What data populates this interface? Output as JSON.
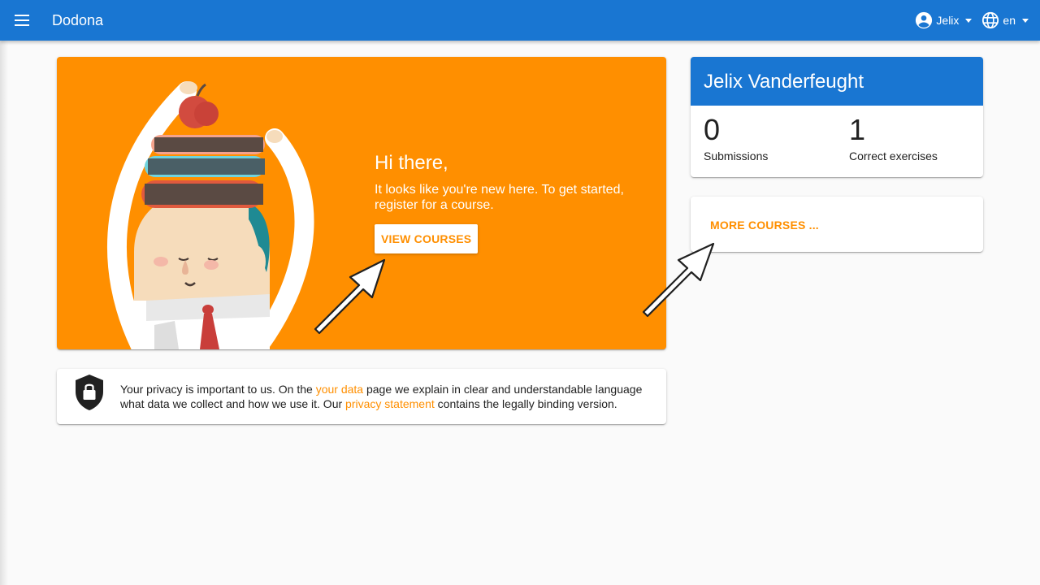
{
  "topbar": {
    "brand": "Dodona",
    "user_label": "Jelix",
    "language_label": "en"
  },
  "hero": {
    "title": "Hi there,",
    "subtitle": "It looks like you're new here. To get started, register for a course.",
    "button_label": "VIEW COURSES"
  },
  "privacy": {
    "text_1": "Your privacy is important to us. On the ",
    "link_1": "your data",
    "text_2": " page we explain in clear and understandable language what data we collect and how we use it. Our ",
    "link_2": "privacy statement",
    "text_3": " contains the legally binding version."
  },
  "profile": {
    "name": "Jelix Vanderfeught",
    "stats": [
      {
        "value": "0",
        "label": "Submissions"
      },
      {
        "value": "1",
        "label": "Correct exercises"
      }
    ]
  },
  "more_courses": {
    "label": "MORE COURSES ..."
  },
  "colors": {
    "primary": "#1976d2",
    "accent": "#ff8f00"
  },
  "icons": [
    "menu-icon",
    "account-circle-icon",
    "globe-icon",
    "shield-lock-icon",
    "arrow-icon"
  ]
}
